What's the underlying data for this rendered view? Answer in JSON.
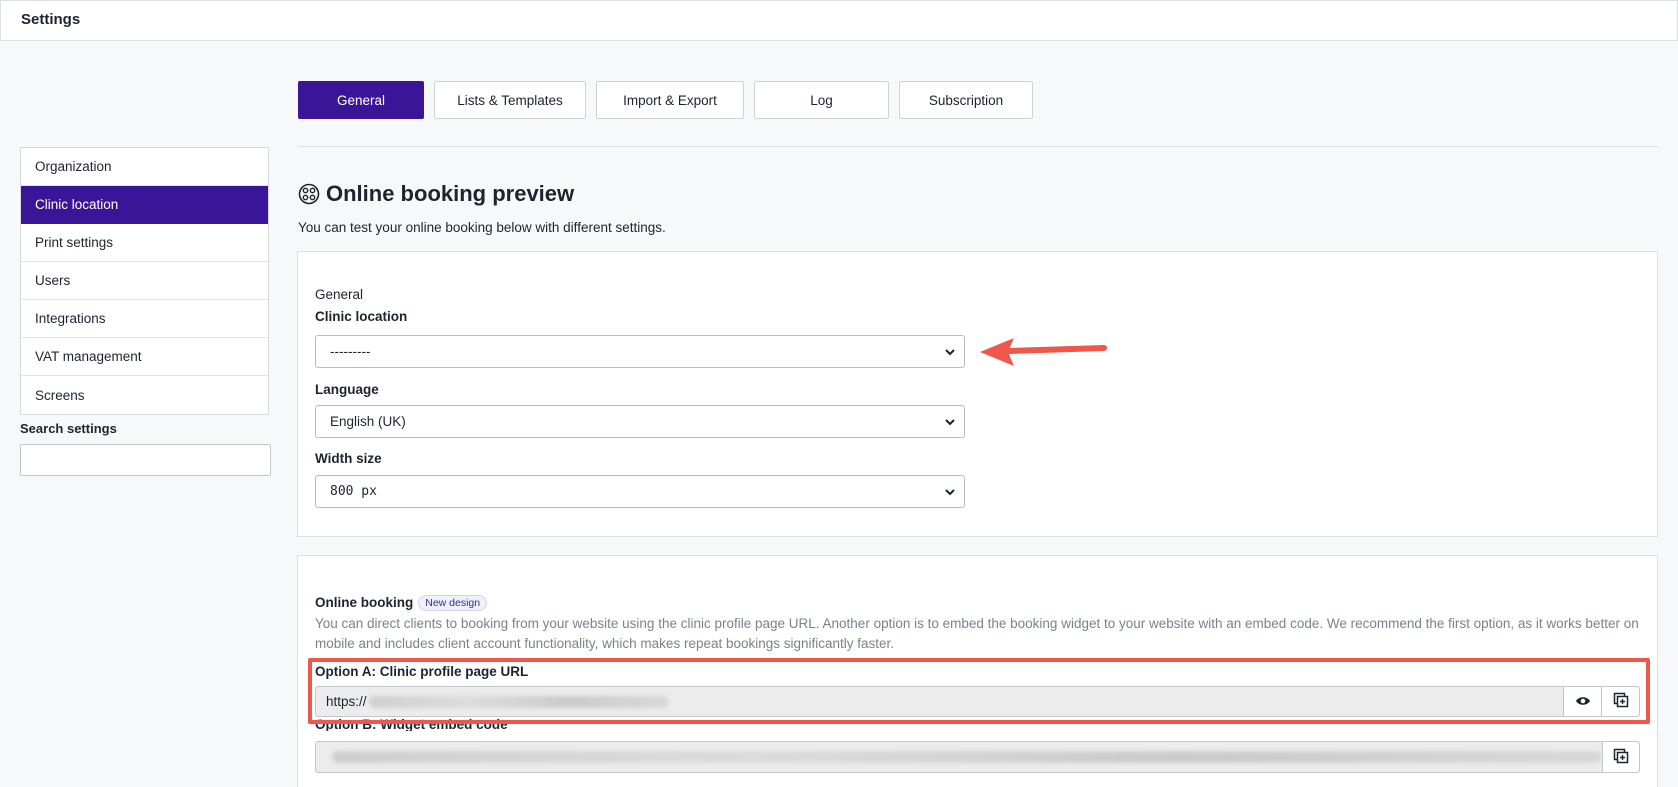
{
  "header": {
    "title": "Settings"
  },
  "tabs": [
    {
      "label": "General",
      "active": true
    },
    {
      "label": "Lists & Templates",
      "active": false
    },
    {
      "label": "Import & Export",
      "active": false
    },
    {
      "label": "Log",
      "active": false
    },
    {
      "label": "Subscription",
      "active": false
    }
  ],
  "sidebar": {
    "items": [
      {
        "label": "Organization",
        "active": false
      },
      {
        "label": "Clinic location",
        "active": true
      },
      {
        "label": "Print settings",
        "active": false
      },
      {
        "label": "Users",
        "active": false
      },
      {
        "label": "Integrations",
        "active": false
      },
      {
        "label": "VAT management",
        "active": false
      },
      {
        "label": "Screens",
        "active": false
      }
    ],
    "search_label": "Search settings",
    "search_value": ""
  },
  "main": {
    "title": "Online booking preview",
    "subtitle": "You can test your online booking below with different settings.",
    "general": {
      "section_label": "General",
      "clinic_location_label": "Clinic location",
      "clinic_location_value": "---------",
      "language_label": "Language",
      "language_value": "English (UK)",
      "width_label": "Width size",
      "width_value": "800 px"
    },
    "online_booking": {
      "label": "Online booking",
      "badge": "New design",
      "description": "You can direct clients to booking from your website using the clinic profile page URL. Another option is to embed the booking widget to your website with an embed code. We recommend the first option, as it works better on mobile and includes client account functionality, which makes repeat bookings significantly faster.",
      "option_a_label": "Option A: Clinic profile page URL",
      "option_a_value": "https://",
      "option_b_label": "Option B: Widget embed code"
    }
  },
  "colors": {
    "accent": "#3b1597",
    "annotation": "#f0574b"
  },
  "icons": {
    "heading": "booking-preview-icon",
    "chevron": "chevron-down-icon",
    "eye": "eye-icon",
    "copy": "copy-icon"
  }
}
